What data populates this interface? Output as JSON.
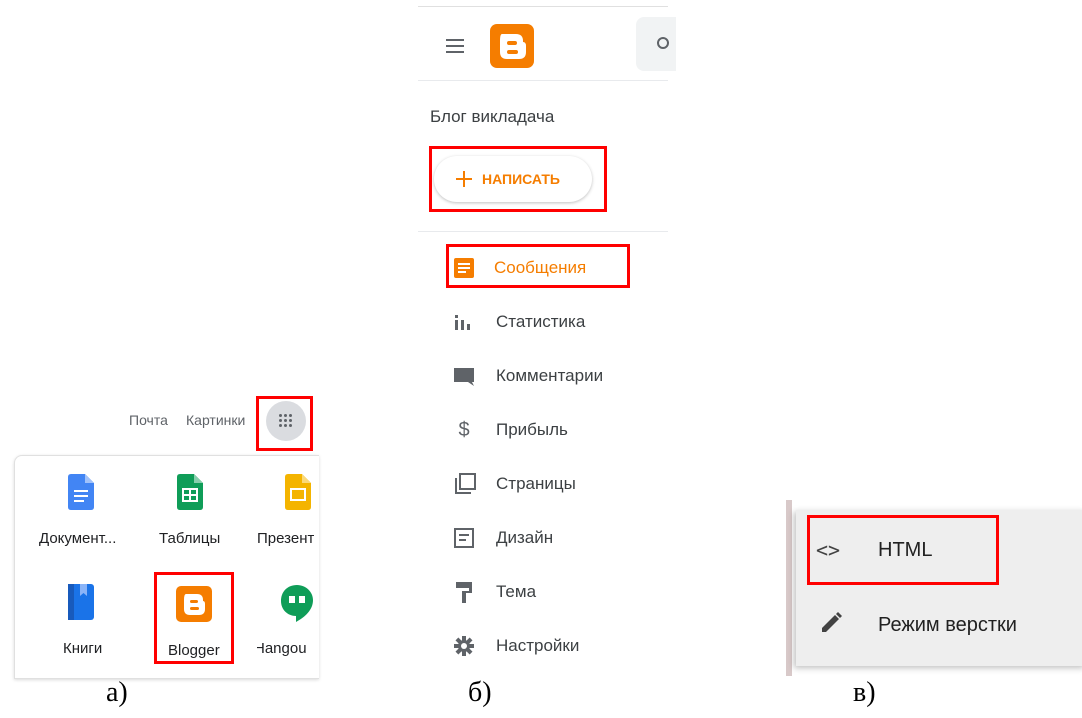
{
  "panel_a": {
    "top_links": [
      "Почта",
      "Картинки"
    ],
    "apps": [
      {
        "label": "Документ...",
        "icon": "google-docs-icon",
        "color": "#4285f4"
      },
      {
        "label": "Таблицы",
        "icon": "google-sheets-icon",
        "color": "#0f9d58"
      },
      {
        "label": "Презент",
        "icon": "google-slides-icon",
        "color": "#f4b400"
      },
      {
        "label": "Книги",
        "icon": "google-books-icon",
        "color": "#1a73e8"
      },
      {
        "label": "Blogger",
        "icon": "blogger-icon",
        "color": "#f57d00"
      },
      {
        "label": "Hangou",
        "icon": "hangouts-icon",
        "color": "#0f9d58"
      }
    ],
    "caption": "а)"
  },
  "panel_b": {
    "blog_title": "Блог викладача",
    "new_post_label": "НАПИСАТЬ",
    "nav": [
      {
        "label": "Сообщения",
        "icon": "posts-icon",
        "active": true
      },
      {
        "label": "Статистика",
        "icon": "stats-icon"
      },
      {
        "label": "Комментарии",
        "icon": "comments-icon"
      },
      {
        "label": "Прибыль",
        "icon": "dollar-icon"
      },
      {
        "label": "Страницы",
        "icon": "pages-icon"
      },
      {
        "label": "Дизайн",
        "icon": "layout-icon"
      },
      {
        "label": "Тема",
        "icon": "theme-icon"
      },
      {
        "label": "Настройки",
        "icon": "settings-icon"
      }
    ],
    "caption": "б)",
    "accent": "#f57d00"
  },
  "panel_c": {
    "items": [
      {
        "label": "HTML",
        "icon": "code-icon"
      },
      {
        "label": "Режим верстки",
        "icon": "pencil-icon"
      }
    ],
    "caption": "в)"
  },
  "highlight_color": "#ff0000"
}
